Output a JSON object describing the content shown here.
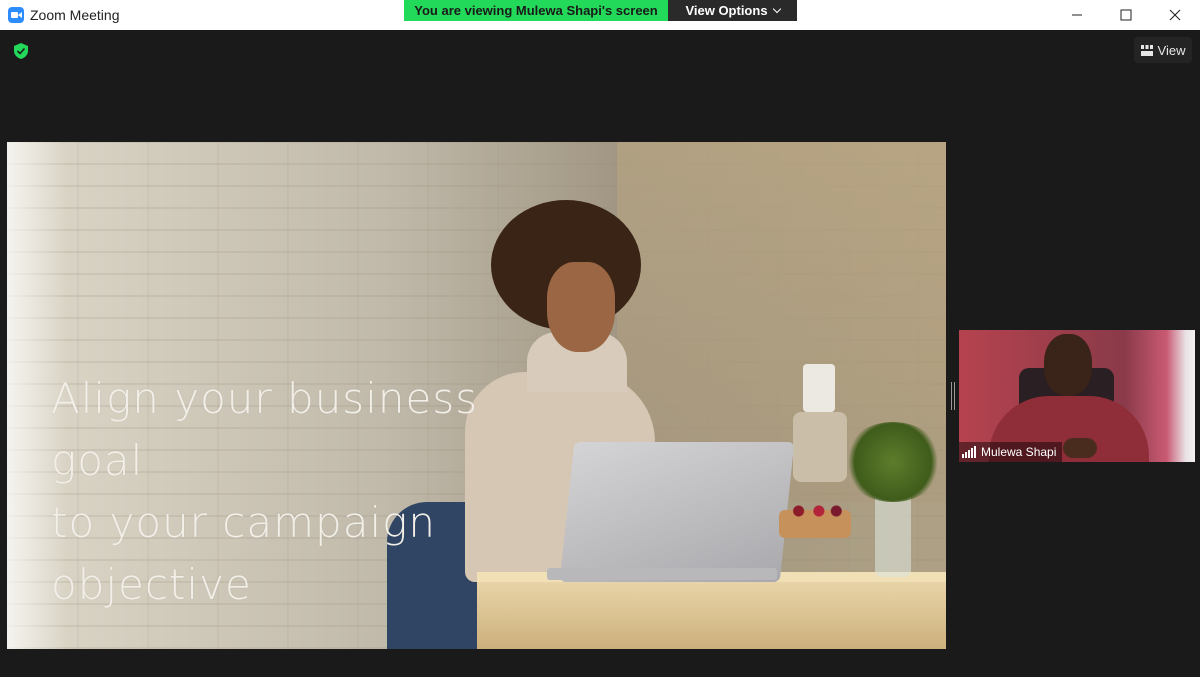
{
  "window": {
    "title": "Zoom Meeting",
    "minimize_label": "Minimize",
    "maximize_label": "Maximize",
    "close_label": "Close"
  },
  "share_banner": {
    "status_text": "You are viewing Mulewa Shapi's screen",
    "view_options_label": "View Options",
    "status_color": "#23d959"
  },
  "toolbar": {
    "view_label": "View",
    "security_icon": "shield-check-icon"
  },
  "shared_slide": {
    "lines": [
      "Align your business",
      "goal",
      "to your campaign",
      "objective"
    ]
  },
  "participant": {
    "name": "Mulewa Shapi",
    "signal_icon": "signal-bars-icon"
  }
}
